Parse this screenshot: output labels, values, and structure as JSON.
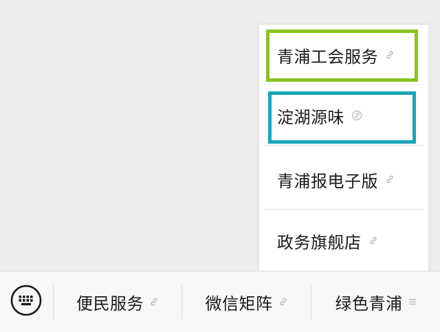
{
  "bottom_bar": {
    "keyboard_icon": "keyboard-icon",
    "items": [
      {
        "label": "便民服务",
        "icon": "link-icon"
      },
      {
        "label": "微信矩阵",
        "icon": "link-icon"
      },
      {
        "label": "绿色青浦",
        "icon": "menu-lines-icon"
      }
    ]
  },
  "submenu": {
    "items": [
      {
        "label": "青浦工会服务",
        "icon": "link-icon"
      },
      {
        "label": "淀湖源味",
        "icon": "miniprogram-icon"
      },
      {
        "label": "青浦报电子版",
        "icon": "link-icon"
      },
      {
        "label": "政务旗舰店",
        "icon": "link-icon"
      }
    ]
  },
  "highlight_colors": {
    "green": "#8cc21f",
    "teal": "#17a6b8"
  }
}
